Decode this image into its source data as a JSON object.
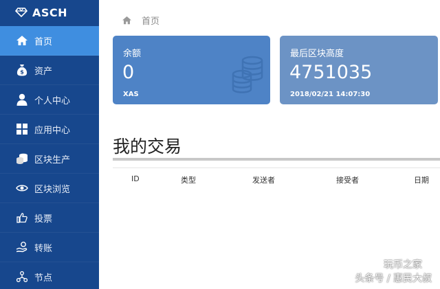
{
  "app": {
    "brand": "ASCH"
  },
  "sidebar": {
    "items": [
      {
        "label": "首页",
        "icon": "home-icon",
        "active": true
      },
      {
        "label": "资产",
        "icon": "money-bag-icon"
      },
      {
        "label": "个人中心",
        "icon": "user-icon"
      },
      {
        "label": "应用中心",
        "icon": "apps-grid-icon"
      },
      {
        "label": "区块生产",
        "icon": "coins-stack-icon"
      },
      {
        "label": "区块浏览",
        "icon": "eye-icon"
      },
      {
        "label": "投票",
        "icon": "thumbs-up-icon"
      },
      {
        "label": "转账",
        "icon": "transfer-hand-icon"
      },
      {
        "label": "节点",
        "icon": "nodes-icon"
      }
    ]
  },
  "breadcrumb": {
    "label": "首页"
  },
  "cards": {
    "balance": {
      "label": "余额",
      "value": "0",
      "unit": "XAS"
    },
    "height": {
      "label": "最后区块高度",
      "value": "4751035",
      "time": "2018/02/21 14:07:30"
    }
  },
  "transactions": {
    "title": "我的交易",
    "columns": [
      "ID",
      "类型",
      "发送者",
      "接受者",
      "日期"
    ]
  },
  "watermark": {
    "line1": "玩币之家",
    "line2": "头条号 / 惠民大叔"
  },
  "colors": {
    "sidebar": "#17478d",
    "active": "#3f8ee0",
    "card_balance": "#4e83c6",
    "card_height": "#6c93c5"
  }
}
